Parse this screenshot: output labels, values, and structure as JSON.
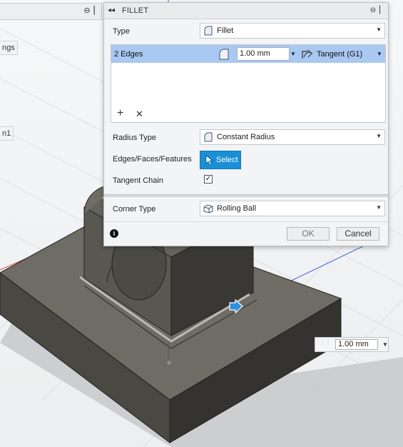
{
  "left_panel": {
    "fragment_1": "ngs",
    "fragment_2": "n1"
  },
  "dialog": {
    "title": "FILLET",
    "type_label": "Type",
    "type_value": "Fillet",
    "edges": {
      "label": "2 Edges",
      "radius": "1.00 mm",
      "continuity": "Tangent (G1)"
    },
    "radius_type_label": "Radius Type",
    "radius_type_value": "Constant Radius",
    "edges_faces_label": "Edges/Faces/Features",
    "select_label": "Select",
    "tangent_chain_label": "Tangent Chain",
    "tangent_chain_checked": true,
    "corner_type_label": "Corner Type",
    "corner_type_value": "Rolling Ball",
    "ok_label": "OK",
    "cancel_label": "Cancel"
  },
  "canvas_input": {
    "value": "1.00 mm"
  },
  "colors": {
    "selection_row": "#a9c8f2",
    "select_button": "#1a8fd6",
    "model_body": "#5d5a54",
    "axis_red": "#e04040",
    "axis_blue": "#4060e0"
  }
}
